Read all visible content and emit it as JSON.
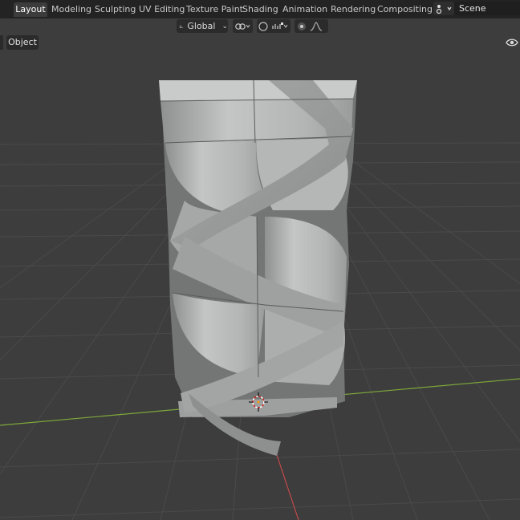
{
  "workspace_tabs": [
    {
      "label": "Layout",
      "active": true
    },
    {
      "label": "Modeling",
      "active": false
    },
    {
      "label": "Sculpting",
      "active": false
    },
    {
      "label": "UV Editing",
      "active": false
    },
    {
      "label": "Texture Paint",
      "active": false
    },
    {
      "label": "Shading",
      "active": false
    },
    {
      "label": "Animation",
      "active": false
    },
    {
      "label": "Rendering",
      "active": false
    },
    {
      "label": "Compositing",
      "active": false
    }
  ],
  "scene": {
    "name": "Scene",
    "icon": "scene-icon"
  },
  "viewport_header": {
    "transform_orientation": "Global",
    "pivot_icon": "transform-pivot-icon",
    "snap_icon": "snap-magnet-icon",
    "proportional_icon": "proportional-edit-icon"
  },
  "mode_menu": {
    "label": "Object"
  },
  "colors": {
    "background": "#3d3d3d",
    "grid": "#4a4a4a",
    "x_axis": "#c04848",
    "y_axis": "#7ea83a",
    "mesh": "#b9bbbb",
    "active_tab": "#3c3c3c"
  }
}
